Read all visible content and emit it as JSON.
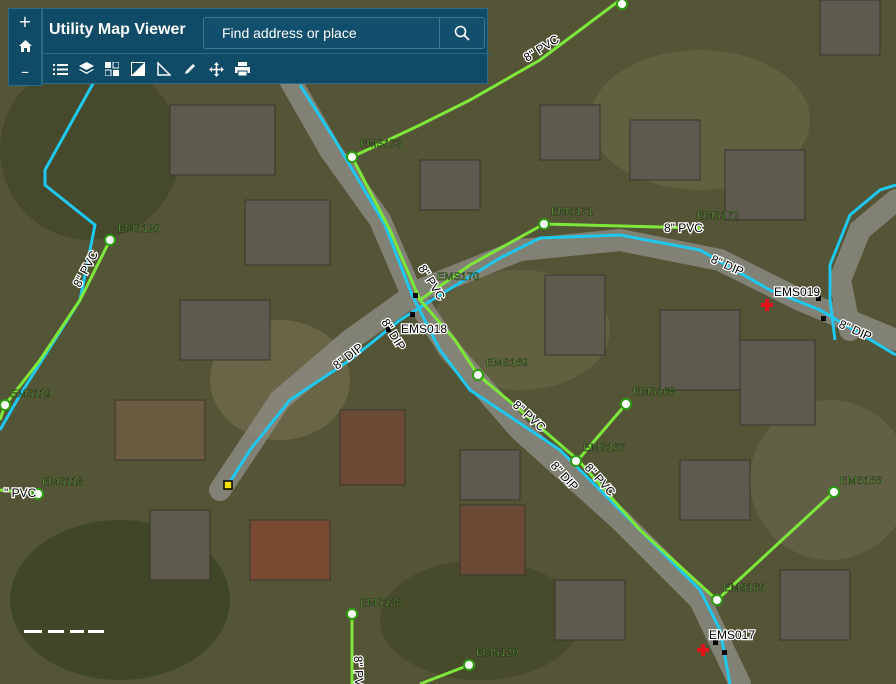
{
  "app": {
    "title": "Utility Map Viewer"
  },
  "search": {
    "placeholder": "Find address or place"
  },
  "zoom": {
    "in": "+",
    "home": "⌂",
    "out": "–"
  },
  "toolbar": {
    "tools": [
      "list-icon",
      "layers-icon",
      "basemap-icon",
      "contrast-icon",
      "measure-icon",
      "draw-icon",
      "move-icon",
      "print-icon"
    ]
  },
  "colors": {
    "water_main": "#1ec8f0",
    "sewer_pvc": "#7de83a",
    "panel": "#0f4a66"
  },
  "manholes": [
    {
      "id": "EMS173",
      "label": "EMS173"
    },
    {
      "id": "EMS171",
      "label": "EMS171"
    },
    {
      "id": "EMS172",
      "label": "EMS172"
    },
    {
      "id": "EMS170",
      "label": "EMS170"
    },
    {
      "id": "EMS169",
      "label": "EMS169"
    },
    {
      "id": "EMS168",
      "label": "EMS168"
    },
    {
      "id": "EMS167",
      "label": "EMS167"
    },
    {
      "id": "EMS166",
      "label": "EMS166"
    },
    {
      "id": "EMS165",
      "label": "EMS165"
    },
    {
      "id": "EMS120",
      "label": "EMS120"
    },
    {
      "id": "EMS119",
      "label": "EMS119"
    },
    {
      "id": "EMS118",
      "label": "EMS118"
    },
    {
      "id": "EMS128",
      "label": "EMS128"
    },
    {
      "id": "EMS129",
      "label": "EMS129"
    }
  ],
  "valves": [
    {
      "id": "EMS018",
      "label": "EMS018"
    },
    {
      "id": "EMS019",
      "label": "EMS019"
    },
    {
      "id": "EMS017",
      "label": "EMS017"
    }
  ],
  "pipe_labels": {
    "pvc_a": "8\" PVC",
    "pvc_b": "8\" PVC",
    "pvc_c": "8\" PVC",
    "pvc_d": "8\" PVC",
    "pvc_e": "8\" PVC",
    "pvc_f": "8\" PVC",
    "pvc_g": "\" PVC",
    "pvc_h": "8\" PVC",
    "pvc_i": "8\" PVC",
    "dip_a": "8\" DIP",
    "dip_b": "8\" DIP",
    "dip_c": "8\" DIP",
    "dip_d": "8\" DIP",
    "dip_e": "8\" DIP"
  }
}
